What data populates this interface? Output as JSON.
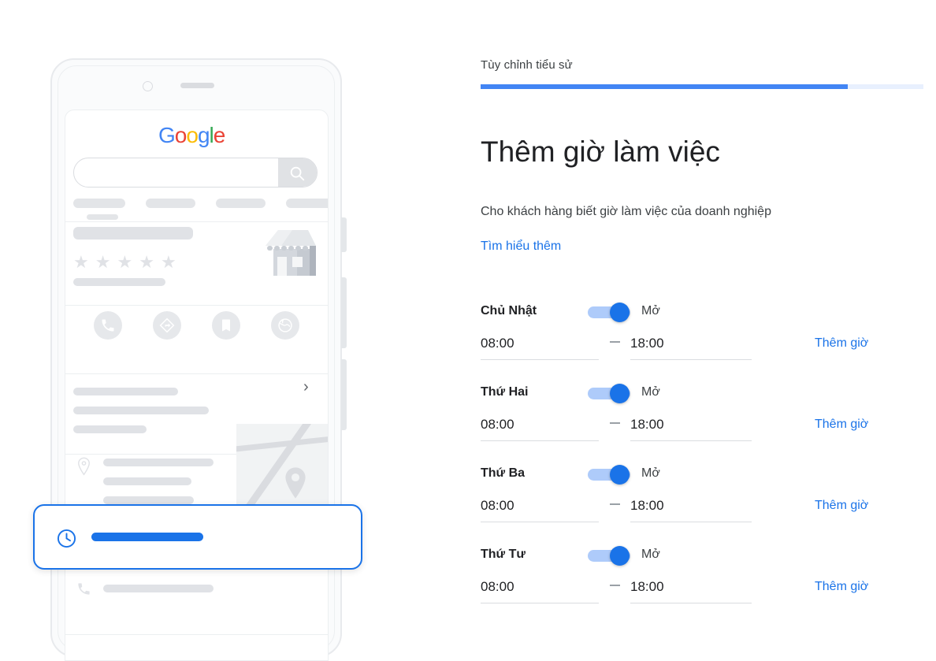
{
  "illustration": {
    "phone_mockup": {
      "brand_logo": {
        "name": "google-logo",
        "letters": [
          "G",
          "o",
          "o",
          "g",
          "l",
          "e"
        ]
      },
      "search_placeholder": "",
      "icons": {
        "camera": "camera-icon",
        "speaker": "speaker-icon",
        "search": "search-icon",
        "store": "storefront-icon",
        "call": "phone-icon",
        "directions": "directions-icon",
        "save": "bookmark-icon",
        "website": "globe-icon",
        "chevron": "chevron-right-icon",
        "location": "map-pin-icon",
        "phone_row": "phone-icon",
        "clock": "clock-icon"
      },
      "rating_stars": 5
    },
    "toast": {
      "icon": "clock-icon",
      "accent_color": "#1a73e8"
    }
  },
  "panel": {
    "step_label": "Tùy chỉnh tiểu sử",
    "progress": {
      "percent": 83,
      "fill_color": "#4285f4",
      "track_color": "#e8f0fe"
    },
    "title": "Thêm giờ làm việc",
    "subtitle": "Cho khách hàng biết giờ làm việc của doanh nghiệp",
    "learn_more_label": "Tìm hiểu thêm",
    "link_color": "#1a73e8",
    "days": [
      {
        "name": "Chủ Nhật",
        "state_label": "Mở",
        "open": true,
        "start_time": "08:00",
        "end_time": "18:00",
        "separator": "–",
        "add_hours_label": "Thêm giờ"
      },
      {
        "name": "Thứ Hai",
        "state_label": "Mở",
        "open": true,
        "start_time": "08:00",
        "end_time": "18:00",
        "separator": "–",
        "add_hours_label": "Thêm giờ"
      },
      {
        "name": "Thứ Ba",
        "state_label": "Mở",
        "open": true,
        "start_time": "08:00",
        "end_time": "18:00",
        "separator": "–",
        "add_hours_label": "Thêm giờ"
      },
      {
        "name": "Thứ Tư",
        "state_label": "Mở",
        "open": true,
        "start_time": "08:00",
        "end_time": "18:00",
        "separator": "–",
        "add_hours_label": "Thêm giờ"
      }
    ]
  }
}
